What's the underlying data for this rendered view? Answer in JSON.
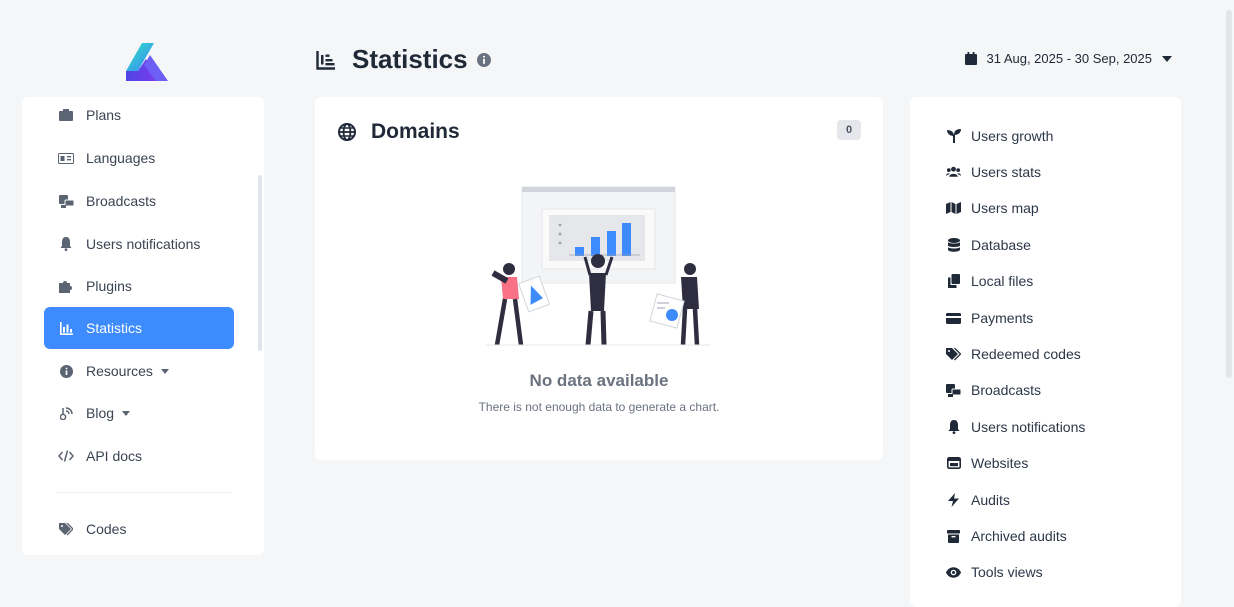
{
  "sidebar": {
    "items": [
      {
        "label": "Plans",
        "icon": "box-icon"
      },
      {
        "label": "Languages",
        "icon": "language-icon"
      },
      {
        "label": "Broadcasts",
        "icon": "broadcast-icon"
      },
      {
        "label": "Users notifications",
        "icon": "bell-icon"
      },
      {
        "label": "Plugins",
        "icon": "puzzle-icon"
      },
      {
        "label": "Statistics",
        "icon": "chart-icon",
        "active": true
      },
      {
        "label": "Resources",
        "icon": "info-icon",
        "dropdown": true
      },
      {
        "label": "Blog",
        "icon": "blog-icon",
        "dropdown": true
      },
      {
        "label": "API docs",
        "icon": "code-icon"
      },
      {
        "label": "Codes",
        "icon": "tag-icon"
      }
    ]
  },
  "header": {
    "title": "Statistics",
    "date_range": "31 Aug, 2025 - 30 Sep, 2025"
  },
  "card": {
    "title": "Domains",
    "count": "0",
    "empty_title": "No data available",
    "empty_subtitle": "There is not enough data to generate a chart."
  },
  "stats_nav": {
    "items": [
      {
        "label": "Users growth",
        "icon": "seedling-icon"
      },
      {
        "label": "Users stats",
        "icon": "users-icon"
      },
      {
        "label": "Users map",
        "icon": "map-icon"
      },
      {
        "label": "Database",
        "icon": "database-icon"
      },
      {
        "label": "Local files",
        "icon": "copy-icon"
      },
      {
        "label": "Payments",
        "icon": "credit-card-icon"
      },
      {
        "label": "Redeemed codes",
        "icon": "tags-icon"
      },
      {
        "label": "Broadcasts",
        "icon": "broadcast-icon"
      },
      {
        "label": "Users notifications",
        "icon": "bell-icon"
      },
      {
        "label": "Websites",
        "icon": "window-icon"
      },
      {
        "label": "Audits",
        "icon": "bolt-icon"
      },
      {
        "label": "Archived audits",
        "icon": "archive-icon"
      },
      {
        "label": "Tools views",
        "icon": "eye-icon"
      }
    ]
  },
  "colors": {
    "accent": "#3d8bfd",
    "background": "#f5f6f8"
  }
}
